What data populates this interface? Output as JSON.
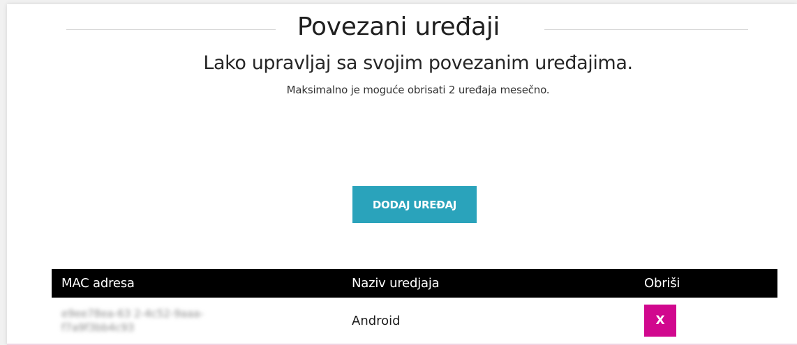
{
  "header": {
    "title": "Povezani uređaji",
    "subtitle": "Lako upravljaj sa svojim povezanim uređajima.",
    "note": "Maksimalno je moguće obrisati 2 uređaja mesečno."
  },
  "actions": {
    "add_device_label": "DODAJ UREĐAJ"
  },
  "table": {
    "columns": [
      "MAC adresa",
      "Naziv uredjaja",
      "Obriši"
    ],
    "rows": [
      {
        "mac": "e9ee78ea-63 2-4c52-9aaa-f7a9f3bb4c93",
        "name": "Android",
        "delete_label": "X"
      }
    ]
  },
  "colors": {
    "accent_teal": "#2aa3bb",
    "delete_magenta": "#d1088e",
    "header_black": "#000000"
  }
}
